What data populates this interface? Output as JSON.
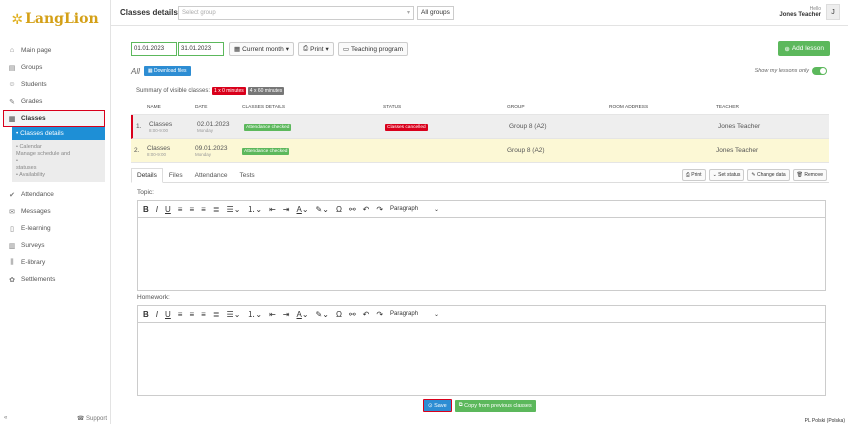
{
  "app": {
    "logo_text": "LangLion"
  },
  "sidebar": {
    "items": [
      {
        "label": "Main page",
        "icon": "home-icon"
      },
      {
        "label": "Groups",
        "icon": "groups-icon"
      },
      {
        "label": "Students",
        "icon": "students-icon"
      },
      {
        "label": "Grades",
        "icon": "grades-icon"
      },
      {
        "label": "Classes",
        "icon": "classes-icon"
      }
    ],
    "sub_active": "• Classes details",
    "sub_items": [
      "• Calendar",
      "Manage schedule and",
      "•",
      "statuses",
      "• Availability"
    ],
    "items_after": [
      {
        "label": "Attendance",
        "icon": "attendance-icon"
      },
      {
        "label": "Messages",
        "icon": "messages-icon"
      },
      {
        "label": "E-learning",
        "icon": "elearning-icon"
      },
      {
        "label": "Surveys",
        "icon": "surveys-icon"
      },
      {
        "label": "E-library",
        "icon": "elibrary-icon"
      },
      {
        "label": "Settlements",
        "icon": "settlements-icon"
      }
    ],
    "support": "Support"
  },
  "topbar": {
    "title": "Classes details",
    "group_placeholder": "Select group",
    "all_groups": "All groups",
    "hello": "Hello",
    "user_name": "Jones Teacher",
    "avatar_letter": "J"
  },
  "toolbar": {
    "date_from": "01.01.2023",
    "date_to": "31.01.2023",
    "current_month": "Current month",
    "print": "Print",
    "teaching_program": "Teaching program",
    "add_lesson": "Add lesson"
  },
  "filters": {
    "all_label": "All",
    "download_files": "Download files",
    "show_my_lessons": "Show my lessons only"
  },
  "summary": {
    "label": "Summary of visible classes:",
    "badge_red": "1 x 0 minutes",
    "badge_gray": "4 x 60 minutes",
    "badge_red_color": "#d9001b",
    "badge_gray_color": "#777777"
  },
  "table": {
    "headers": [
      "NAME",
      "DATE",
      "CLASSES DETAILS",
      "STATUS",
      "GROUP",
      "ROOM ADDRESS",
      "TEACHER"
    ],
    "rows": [
      {
        "num": "1.",
        "name": "Classes",
        "time": "8:00-9:00",
        "date": "02.01.2023",
        "day": "Monday",
        "details": "Attendance checked",
        "status": "Classes cancelled",
        "group": "Group 8 (A2)",
        "room": "",
        "teacher": "Jones Teacher"
      },
      {
        "num": "2.",
        "name": "Classes",
        "time": "8:00-9:00",
        "date": "09.01.2023",
        "day": "Monday",
        "details": "Attendance checked",
        "status": "",
        "group": "Group 8 (A2)",
        "room": "",
        "teacher": "Jones Teacher"
      }
    ]
  },
  "tabs": [
    "Details",
    "Files",
    "Attendance",
    "Tests"
  ],
  "tab_actions": {
    "print": "Print",
    "set_status": "Set status",
    "change_data": "Change data",
    "remove": "Remove"
  },
  "editor": {
    "topic_label": "Topic:",
    "homework_label": "Homework:",
    "paragraph": "Paragraph"
  },
  "actions": {
    "save": "Save",
    "copy_previous": "Copy from previous classes"
  },
  "language": "PL Polski (Polska)"
}
